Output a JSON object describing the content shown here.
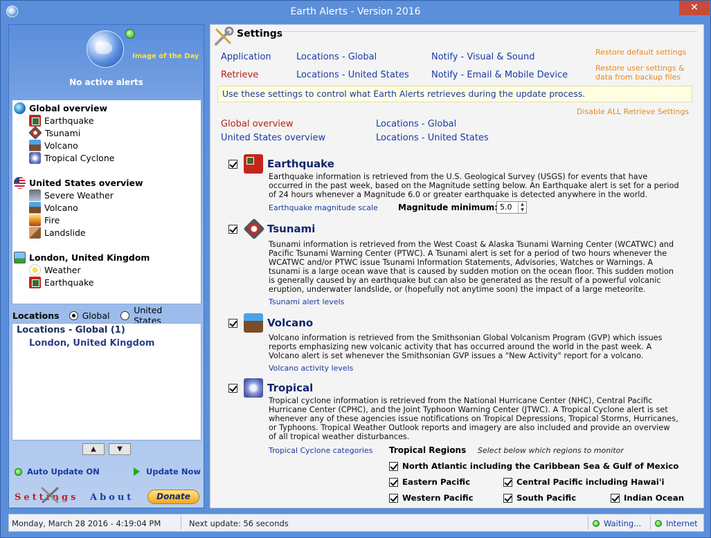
{
  "window": {
    "title": "Earth Alerts - Version 2016",
    "close_glyph": "✕"
  },
  "sidebar": {
    "image_of_day": "Image of the Day",
    "no_alerts": "No active alerts",
    "tree": {
      "global": {
        "label": "Global overview",
        "items": [
          "Earthquake",
          "Tsunami",
          "Volcano",
          "Tropical Cyclone"
        ]
      },
      "us": {
        "label": "United States overview",
        "items": [
          "Severe Weather",
          "Volcano",
          "Fire",
          "Landslide"
        ]
      },
      "london": {
        "label": "London, United Kingdom",
        "items": [
          "Weather",
          "Earthquake"
        ]
      }
    },
    "locations_label": "Locations",
    "radio_global": "Global",
    "radio_us": "United States",
    "loc_list_header": "Locations - Global (1)",
    "loc_list_items": [
      "London, United Kingdom"
    ],
    "up_glyph": "▲",
    "down_glyph": "▼",
    "auto_update": "Auto Update ON",
    "update_now": "Update Now",
    "settings_link": "Settings",
    "about_link": "About",
    "donate": "Donate"
  },
  "settings": {
    "title": "Settings",
    "nav": {
      "application": "Application",
      "locations_global": "Locations - Global",
      "notify_visual": "Notify - Visual & Sound",
      "retrieve": "Retrieve",
      "locations_us": "Locations - United States",
      "notify_email": "Notify - Email & Mobile Device"
    },
    "restore_default": "Restore default settings",
    "restore_user_1": "Restore user settings &",
    "restore_user_2": "data from backup files",
    "info": "Use these settings to control what Earth Alerts retrieves during the update process.",
    "disable_all": "Disable ALL Retrieve Settings",
    "sub_nav": {
      "global_overview": "Global overview",
      "us_overview": "United States overview",
      "locations_global": "Locations - Global",
      "locations_us": "Locations - United States"
    },
    "sections": {
      "earthquake": {
        "title": "Earthquake",
        "desc": [
          "Earthquake information is retrieved from the U.S. Geological Survey (USGS) for events that have",
          "occurred in the past week, based on the Magnitude setting below.  An Earthquake alert is set for a period",
          "of 24 hours whenever a Magnitude 6.0 or greater earthquake is detected anywhere in the world."
        ],
        "link": "Earthquake magnitude scale",
        "mag_label": "Magnitude minimum:",
        "mag_value": "5.0"
      },
      "tsunami": {
        "title": "Tsunami",
        "desc": [
          "Tsunami information is retrieved from the West Coast & Alaska Tsunami Warning Center (WCATWC) and",
          "Pacific Tsunami Warning Center (PTWC).  A Tsunami alert is set for a period of two hours whenever the",
          "WCATWC and/or PTWC issue Tsunami Information Statements, Advisories, Watches or Warnings.  A",
          "tsunami is a large ocean wave that is caused by sudden motion on the ocean floor. This sudden motion",
          "is generally caused by an earthquake but can also be generated as the result of a powerful volcanic",
          "eruption, underwater landslide, or (hopefully not anytime soon) the impact of a large meteorite."
        ],
        "link": "Tsunami alert levels"
      },
      "volcano": {
        "title": "Volcano",
        "desc": [
          "Volcano information is retrieved from the Smithsonian Global Volcanism Program (GVP) which issues",
          "reports emphasizing new volcanic activity that has occurred around the world in the past week.  A",
          "Volcano alert is set whenever the Smithsonian GVP issues a \"New Activity\" report for a volcano."
        ],
        "link": "Volcano activity levels"
      },
      "tropical": {
        "title": "Tropical",
        "desc": [
          "Tropical cyclone information is retrieved from the National Hurricane Center (NHC), Central Pacific",
          "Hurricane Center (CPHC), and the Joint Typhoon Warning Center (JTWC).  A Tropical Cyclone alert is set",
          "whenever any of these agencies issue notifications on Tropical Depressions, Tropical Storms, Hurricanes,",
          "or Typhoons.  Tropical Weather Outlook reports and imagery are also included and provide an overview",
          "of all tropical weather disturbances."
        ],
        "link": "Tropical Cyclone categories",
        "regions_title": "Tropical Regions",
        "regions_sub": "Select below which regions to monitor",
        "regions": {
          "north_atlantic": "North Atlantic including the Caribbean Sea & Gulf of Mexico",
          "eastern_pacific": "Eastern Pacific",
          "central_pacific": "Central Pacific including Hawai'i",
          "western_pacific": "Western Pacific",
          "south_pacific": "South Pacific",
          "indian_ocean": "Indian Ocean"
        }
      }
    }
  },
  "status": {
    "datetime": "Monday, March 28 2016 - 4:19:04 PM",
    "next_update": "Next update: 56 seconds",
    "waiting": "Waiting...",
    "internet": "Internet"
  },
  "colors": {
    "link": "#1a3aa3",
    "active": "#b32218",
    "orange": "#e88a1a",
    "window": "#5b8fd9"
  }
}
